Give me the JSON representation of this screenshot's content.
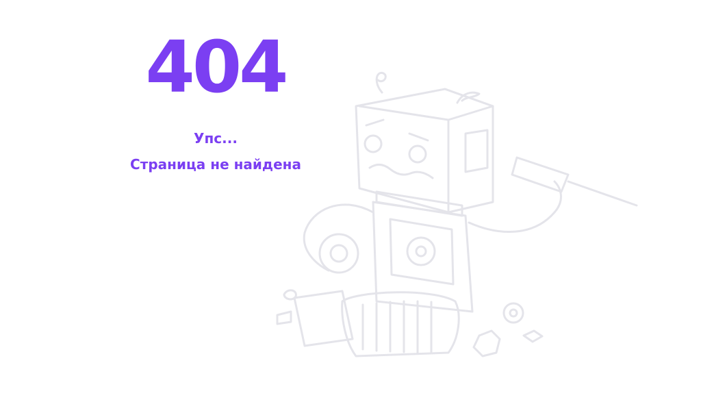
{
  "error": {
    "code": "404",
    "oops": "Упс...",
    "message": "Страница не найдена"
  },
  "theme": {
    "accent": "#7b3ff2",
    "illustration_stroke": "#e4e4ea"
  },
  "illustration": {
    "icon": "broken-robot-icon"
  }
}
